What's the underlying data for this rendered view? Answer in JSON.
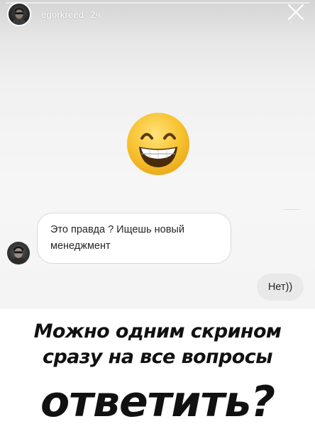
{
  "story": {
    "username": "egorkreed",
    "timestamp": "2ч.",
    "progress": 1.0,
    "emoji_icon": "beaming-face-with-smiling-eyes-icon",
    "close_icon": "close-icon"
  },
  "reply": {
    "question": "Это правда ? Ищешь новый менеджмент",
    "answer": "Нет))"
  },
  "caption": {
    "line1": "Можно одним скрином",
    "line2": "сразу на все вопросы",
    "line3": "ответить?"
  },
  "colors": {
    "emoji_face": "#F7C22E",
    "bubble_border": "#D9D9D9",
    "answer_bubble": "#E9E9E9",
    "caption_text": "#111111"
  }
}
